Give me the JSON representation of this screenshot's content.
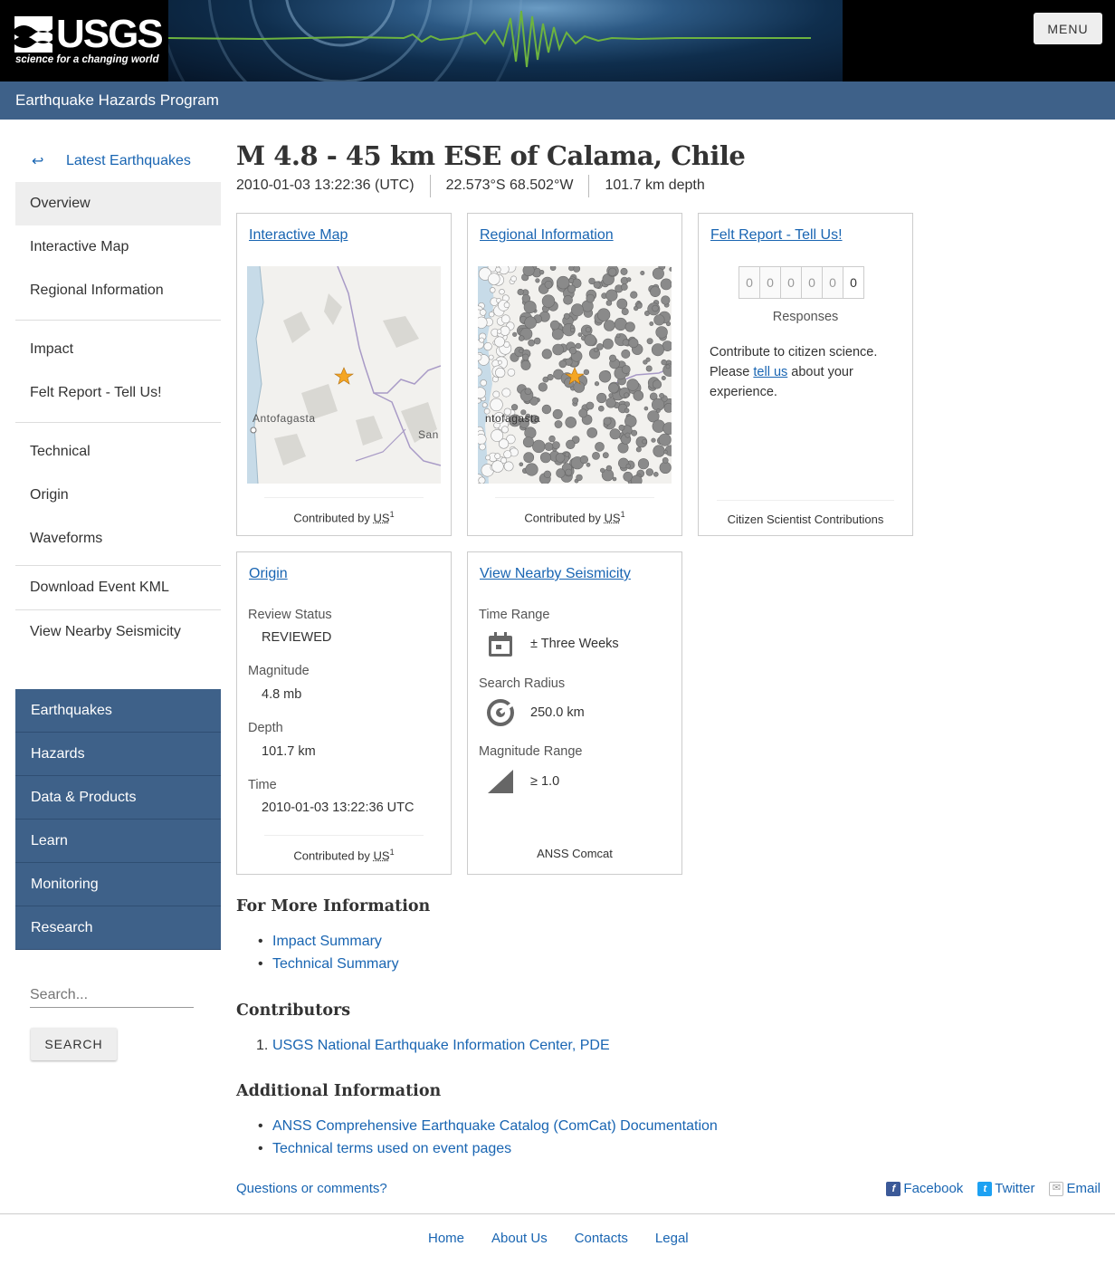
{
  "header": {
    "logo_text": "USGS",
    "logo_tagline": "science for a changing world",
    "menu_label": "MENU",
    "program": "Earthquake Hazards Program"
  },
  "nav": {
    "back_label": "Latest Earthquakes",
    "items": [
      {
        "label": "Overview",
        "active": true
      },
      {
        "label": "Interactive Map"
      },
      {
        "label": "Regional Information"
      },
      {
        "label": "Impact"
      },
      {
        "label": "Felt Report - Tell Us!"
      },
      {
        "label": "Technical"
      },
      {
        "label": "Origin"
      },
      {
        "label": "Waveforms"
      },
      {
        "label": "Download Event KML"
      },
      {
        "label": "View Nearby Seismicity"
      }
    ]
  },
  "site_nav": [
    "Earthquakes",
    "Hazards",
    "Data & Products",
    "Learn",
    "Monitoring",
    "Research"
  ],
  "search": {
    "placeholder": "Search...",
    "button": "SEARCH"
  },
  "event": {
    "title": "M 4.8 - 45 km ESE of Calama, Chile",
    "time": "2010-01-03 13:22:36 (UTC)",
    "location": "22.573°S 68.502°W",
    "depth": "101.7 km depth"
  },
  "cards": {
    "interactive_map": {
      "title": "Interactive Map",
      "foot_prefix": "Contributed by",
      "contributor": "US",
      "sup": "1",
      "label_a": "Antofagasta",
      "label_b": "San"
    },
    "regional": {
      "title": "Regional Information",
      "foot_prefix": "Contributed by",
      "contributor": "US",
      "sup": "1",
      "label_a": "ntofagasta"
    },
    "felt": {
      "title": "Felt Report - Tell Us!",
      "digits": [
        "0",
        "0",
        "0",
        "0",
        "0",
        "0"
      ],
      "responses": "Responses",
      "text1": "Contribute to citizen science. Please",
      "link": "tell us",
      "text2": "about your experience.",
      "foot": "Citizen Scientist Contributions"
    },
    "origin": {
      "title": "Origin",
      "review_label": "Review Status",
      "review": "REVIEWED",
      "mag_label": "Magnitude",
      "mag": "4.8 mb",
      "depth_label": "Depth",
      "depth": "101.7 km",
      "time_label": "Time",
      "time": "2010-01-03 13:22:36 UTC",
      "foot_prefix": "Contributed by",
      "contributor": "US",
      "sup": "1"
    },
    "nearby": {
      "title": "View Nearby Seismicity",
      "range_label": "Time Range",
      "range": "± Three Weeks",
      "radius_label": "Search Radius",
      "radius": "250.0 km",
      "mag_label": "Magnitude Range",
      "mag": "≥ 1.0",
      "foot": "ANSS Comcat"
    }
  },
  "more_info": {
    "heading": "For More Information",
    "links": [
      "Impact Summary",
      "Technical Summary"
    ]
  },
  "contributors": {
    "heading": "Contributors",
    "links": [
      "USGS National Earthquake Information Center, PDE"
    ]
  },
  "additional": {
    "heading": "Additional Information",
    "links": [
      "ANSS Comprehensive Earthquake Catalog (ComCat) Documentation",
      "Technical terms used on event pages"
    ]
  },
  "footer": {
    "questions": "Questions or comments?",
    "social": [
      "Facebook",
      "Twitter",
      "Email"
    ],
    "bottom": [
      "Home",
      "About Us",
      "Contacts",
      "Legal"
    ]
  },
  "colors": {
    "brand_blue": "#3e6189",
    "link": "#1965b2"
  }
}
